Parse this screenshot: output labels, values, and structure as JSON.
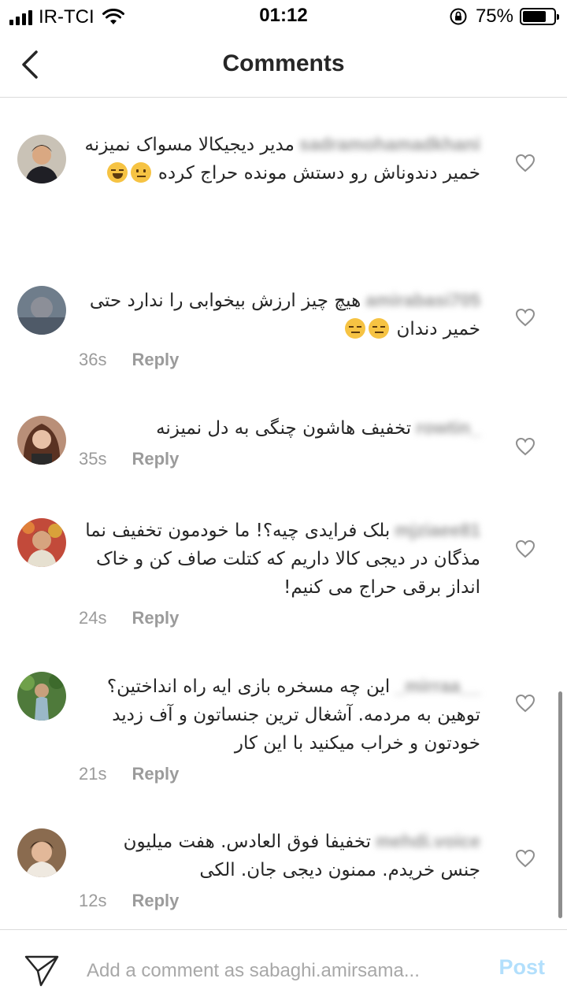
{
  "status_bar": {
    "carrier": "IR-TCI",
    "time": "01:12",
    "battery": "75%",
    "battery_level": 0.75
  },
  "header": {
    "title": "Comments",
    "back_icon": "chevron-left-icon"
  },
  "comments": [
    {
      "username": "sadramohamadkhani",
      "text": "مدیر دیجیکالا مسواک نمیزنه خمیر دندوناش رو دستش مونده حراج کرده",
      "emojis": [
        "neutral",
        "joy"
      ],
      "time": "",
      "reply": ""
    },
    {
      "username": "amirabasi705",
      "text": "هیچ چیز ارزش بیخوابی را ندارد حتی خمیر دندان",
      "emojis": [
        "expressionless",
        "expressionless"
      ],
      "time": "36s",
      "reply": "Reply"
    },
    {
      "username": "rowtin_",
      "text": "تخفیف هاشون چنگی به دل نمیزنه",
      "emojis": [],
      "time": "35s",
      "reply": "Reply"
    },
    {
      "username": "mjziaee81",
      "text": "بلک فرایدی چیه؟! ما خودمون تخفیف نما مذگان در دیجی کالا داریم که کتلت صاف کن و خاک انداز برقی حراج می کنیم!",
      "emojis": [],
      "time": "24s",
      "reply": "Reply"
    },
    {
      "username": "_mirraa__",
      "text": "این چه مسخره بازی ایه راه انداختین؟ توهین به مردمه. آشغال ترین جنساتون و آف زدید خودتون و خراب میکنید با این کار",
      "emojis": [],
      "time": "21s",
      "reply": "Reply"
    },
    {
      "username": "mehdi.voice",
      "text": "تخفیفا فوق العادس. هفت میلیون جنس خریدم. ممنون دیجی جان. الکی",
      "emojis": [],
      "time": "12s",
      "reply": "Reply"
    }
  ],
  "composer": {
    "placeholder": "Add a comment as sabaghi.amirsama...",
    "post_label": "Post",
    "send_icon": "paper-plane-icon"
  },
  "colors": {
    "text": "#262626",
    "meta": "#9b9b9b",
    "post_disabled": "#b2dffc",
    "divider": "#dbdbdb"
  }
}
